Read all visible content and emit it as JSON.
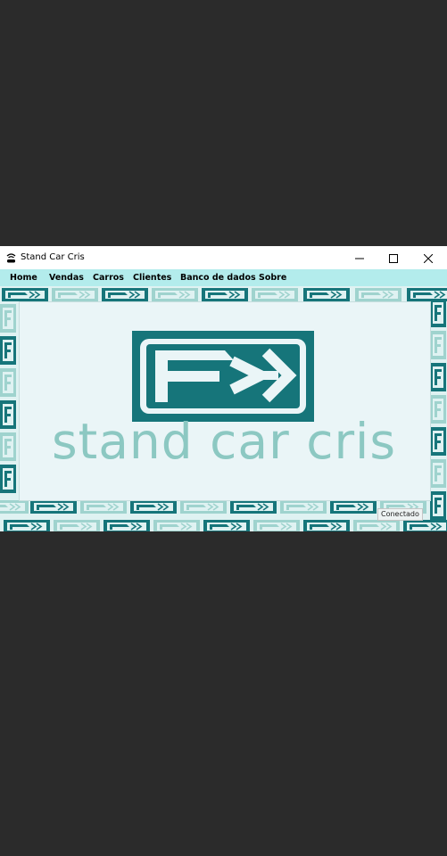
{
  "window": {
    "title": "Stand Car Cris",
    "app_icon": "car-icon",
    "controls": {
      "minimize_icon": "minimize-icon",
      "maximize_icon": "maximize-icon",
      "close_icon": "close-icon"
    }
  },
  "menu": {
    "items": [
      {
        "label": "Home"
      },
      {
        "label": "Vendas"
      },
      {
        "label": "Carros"
      },
      {
        "label": "Clientes"
      },
      {
        "label": "Banco de dados"
      },
      {
        "label": "Sobre"
      }
    ]
  },
  "logo": {
    "brand_text": "stand car cris"
  },
  "status": {
    "text": "Conectado"
  },
  "colors": {
    "desktop": "#2b2b2b",
    "menubar": "#b3ecec",
    "brand_dark": "#16757a",
    "brand_light": "#8cc8c2",
    "panel": "#eaf5f7"
  }
}
